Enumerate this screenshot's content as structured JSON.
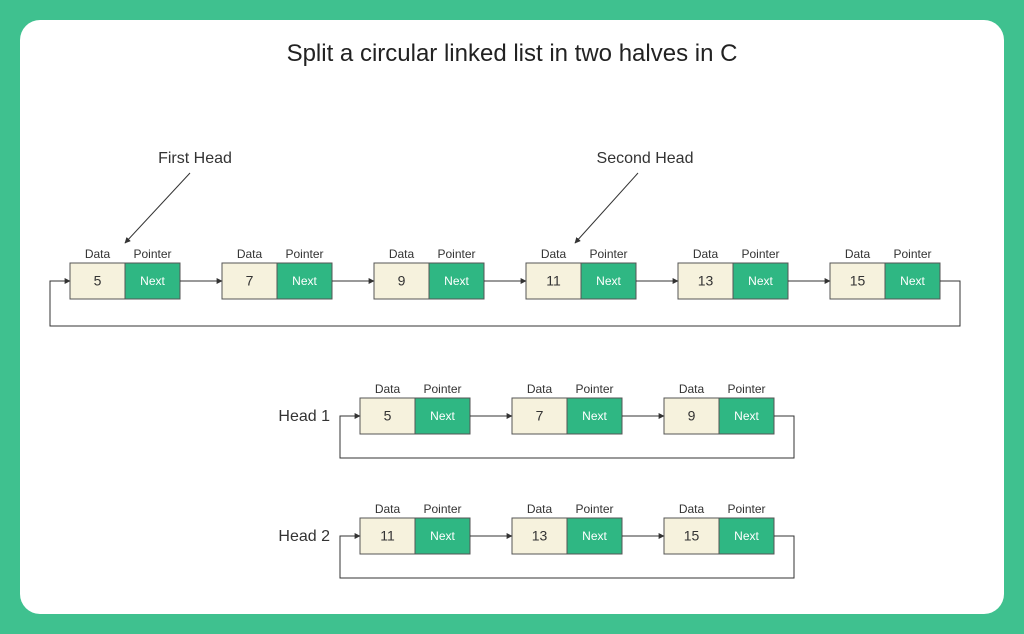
{
  "title": "Split a circular linked list in two halves in C",
  "labels": {
    "first_head": "First Head",
    "second_head": "Second Head",
    "row1": "Head 1",
    "row2": "Head 2",
    "data_header": "Data",
    "pointer_header": "Pointer",
    "next": "Next"
  },
  "main_list": [
    {
      "value": "5"
    },
    {
      "value": "7"
    },
    {
      "value": "9"
    },
    {
      "value": "11"
    },
    {
      "value": "13"
    },
    {
      "value": "15"
    }
  ],
  "head1_list": [
    {
      "value": "5"
    },
    {
      "value": "7"
    },
    {
      "value": "9"
    }
  ],
  "head2_list": [
    {
      "value": "11"
    },
    {
      "value": "13"
    },
    {
      "value": "15"
    }
  ]
}
